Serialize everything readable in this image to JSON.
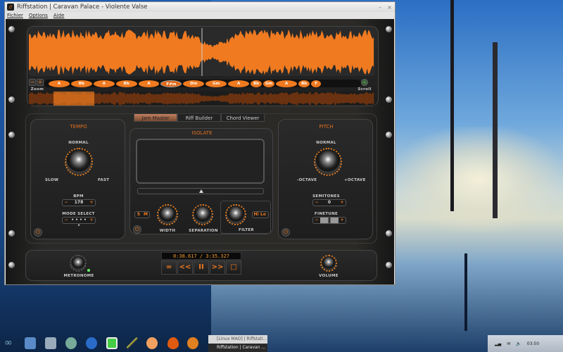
{
  "window": {
    "title": "Riffstation | Caravan Palace - Violente Valse",
    "controls": [
      "–",
      "×"
    ]
  },
  "menu": [
    "Fichier",
    "Options",
    "Aide"
  ],
  "waveform": {
    "zoom_label": "Zoom",
    "zoom_minus": "−",
    "zoom_plus": "+",
    "scroll_label": "Scroll",
    "playhead_fraction": 0.5,
    "chords": [
      "A",
      "Bb",
      "A",
      "Bb",
      "A",
      "F#m",
      "Dm",
      "Gm",
      "A",
      "Bb",
      "Gm",
      "A",
      "Bb",
      "F"
    ],
    "selected_chord": 5
  },
  "tabs": [
    "Jam Master",
    "Riff Builder",
    "Chord Viewer"
  ],
  "active_tab": 0,
  "tempo": {
    "title": "TEMPO",
    "normal": "NORMAL",
    "slow": "SLOW",
    "fast": "FAST",
    "bpm_label": "BPM",
    "bpm": "178",
    "mode_label": "MODE SELECT",
    "mode_value": "• • • • •"
  },
  "isolate": {
    "title": "ISOLATE",
    "s": "S",
    "m": "M",
    "width": "WIDTH",
    "separation": "SEPARATION",
    "filter": "FILTER",
    "hi": "Hi",
    "lo": "Lo",
    "slider_fraction": 0.5
  },
  "pitch": {
    "title": "PITCH",
    "normal": "NORMAL",
    "minus_octave": "-OCTAVE",
    "plus_octave": "+OCTAVE",
    "semitones_label": "SEMITONES",
    "semitones": "0",
    "finetune_label": "FINETUNE"
  },
  "transport": {
    "time": "0:38.617 / 3:35.327",
    "loop": "∞",
    "rewind": "<<",
    "pause": "II",
    "forward": ">>",
    "stop": "□"
  },
  "metronome": "METRONOME",
  "volume": "VOLUME",
  "colors": {
    "accent": "#f07a20",
    "panel": "#2a2a28"
  },
  "taskbar": {
    "windows": [
      "[Linux MAO] | Riffstati...",
      "Riffstation | Caravan ..."
    ],
    "clock": "03:50"
  }
}
